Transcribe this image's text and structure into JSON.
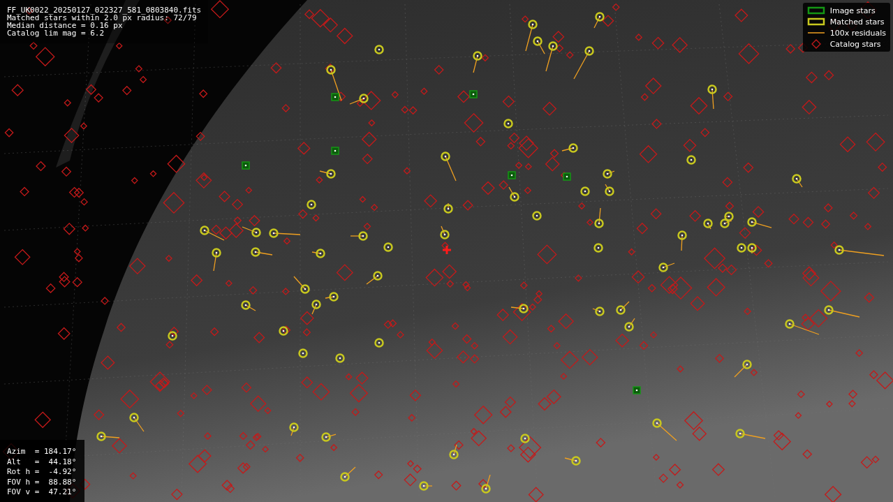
{
  "info": {
    "lines": [
      "FF_UK0022_20250127_022327_581_0803840.fits",
      "Matched stars within 2.0 px radius: 72/79",
      "Median distance = 0.16 px",
      "Catalog lim mag = 6.2"
    ]
  },
  "legend": {
    "items": [
      {
        "kind": "image",
        "label": "Image stars"
      },
      {
        "kind": "matched",
        "label": "Matched stars"
      },
      {
        "kind": "residual",
        "label": "100x residuals"
      },
      {
        "kind": "catalog",
        "label": "Catalog stars"
      }
    ]
  },
  "pointing": {
    "lines": [
      "Azim  = 184.17°",
      "Alt   =  44.18°",
      "Rot h =  -4.92°",
      "FOV h =  88.88°",
      "FOV v =  47.21°"
    ]
  }
}
